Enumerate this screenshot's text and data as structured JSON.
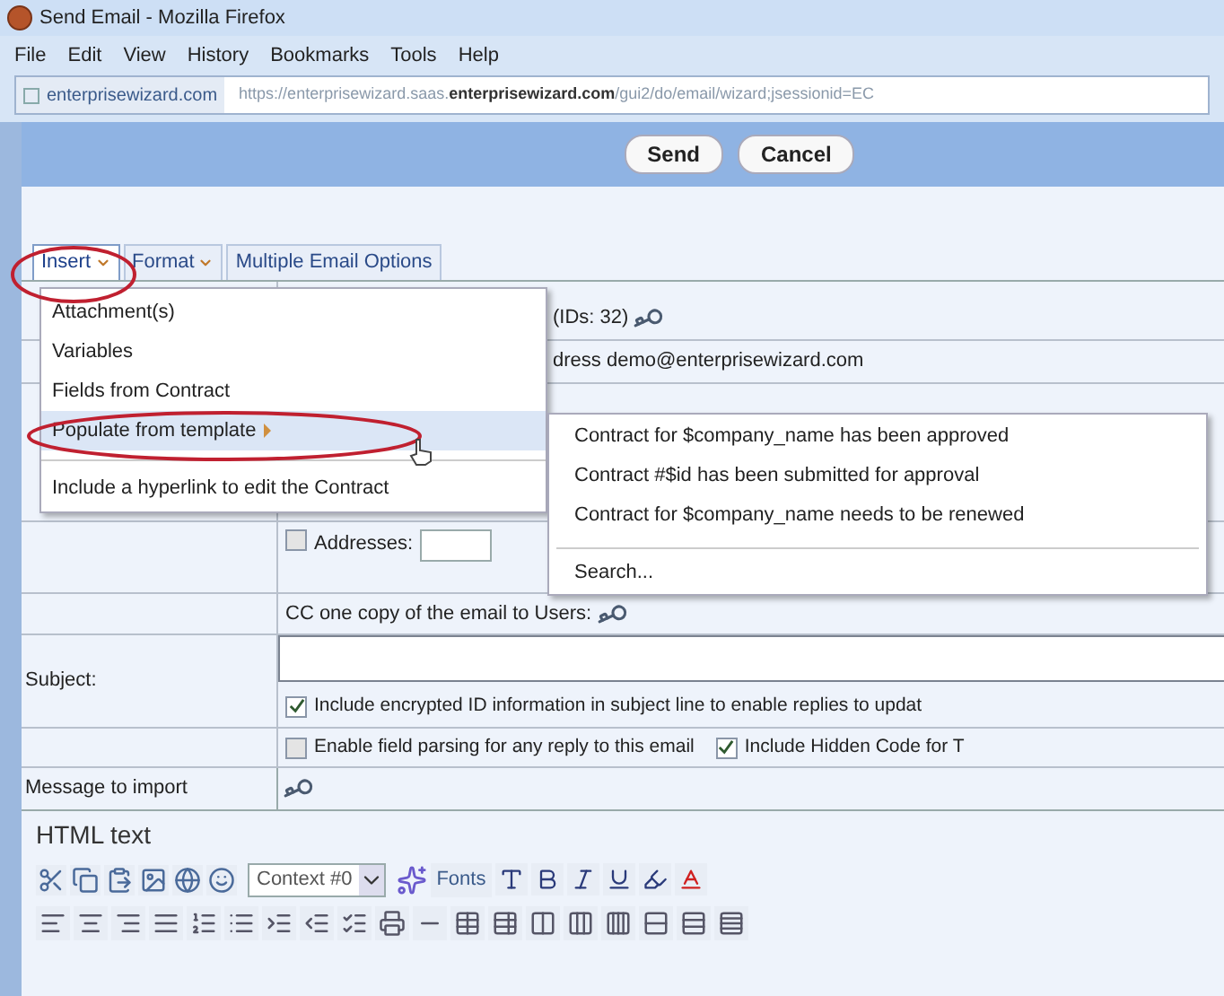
{
  "window": {
    "title": "Send Email - Mozilla Firefox"
  },
  "menu_bar": [
    "File",
    "Edit",
    "View",
    "History",
    "Bookmarks",
    "Tools",
    "Help"
  ],
  "address_bar": {
    "site": "enterprisewizard.com",
    "url_prefix": "https://enterprisewizard.saas.",
    "url_domain": "enterprisewizard.com",
    "url_path": "/gui2/do/email/wizard;jsessionid=EC"
  },
  "actions": [
    "Send",
    "Cancel"
  ],
  "editor_tabs": [
    {
      "label": "Insert",
      "dropdown": true,
      "selected": true
    },
    {
      "label": "Format",
      "dropdown": true,
      "selected": false
    },
    {
      "label": "Multiple Email Options",
      "dropdown": false,
      "selected": false
    }
  ],
  "insert_menu": [
    {
      "label": "Attachment(s)",
      "selected": false,
      "submenu": false
    },
    {
      "label": "Variables",
      "selected": false,
      "submenu": false
    },
    {
      "label": "Fields from Contract",
      "selected": false,
      "submenu": false
    },
    {
      "label": "Populate from template",
      "selected": true,
      "submenu": true
    },
    {
      "label": "Include a hyperlink to edit the Contract",
      "selected": false,
      "submenu": false
    }
  ],
  "template_submenu": {
    "items": [
      "Contract for $company_name has been approved",
      "Contract #$id has been submitted for approval",
      "Contract for $company_name needs to be renewed"
    ],
    "search": "Search..."
  },
  "form": {
    "ids_text": "(IDs: 32)",
    "address_text": "dress demo@enterprisewizard.com",
    "addresses": {
      "label": "Addresses:",
      "checked": false
    },
    "cc_text": "CC one copy of the email to Users:",
    "subject_label": "Subject:",
    "options": [
      {
        "label": "Include encrypted ID information in subject line to enable replies to updat",
        "checked": true
      },
      {
        "label": "Enable field parsing for any reply to this email",
        "checked": false
      },
      {
        "label": "Include Hidden Code for T",
        "checked": true
      }
    ],
    "message_label": "Message to import"
  },
  "html_editor": {
    "label": "HTML text",
    "context_select": "Context #0",
    "fonts_button": "Fonts"
  }
}
